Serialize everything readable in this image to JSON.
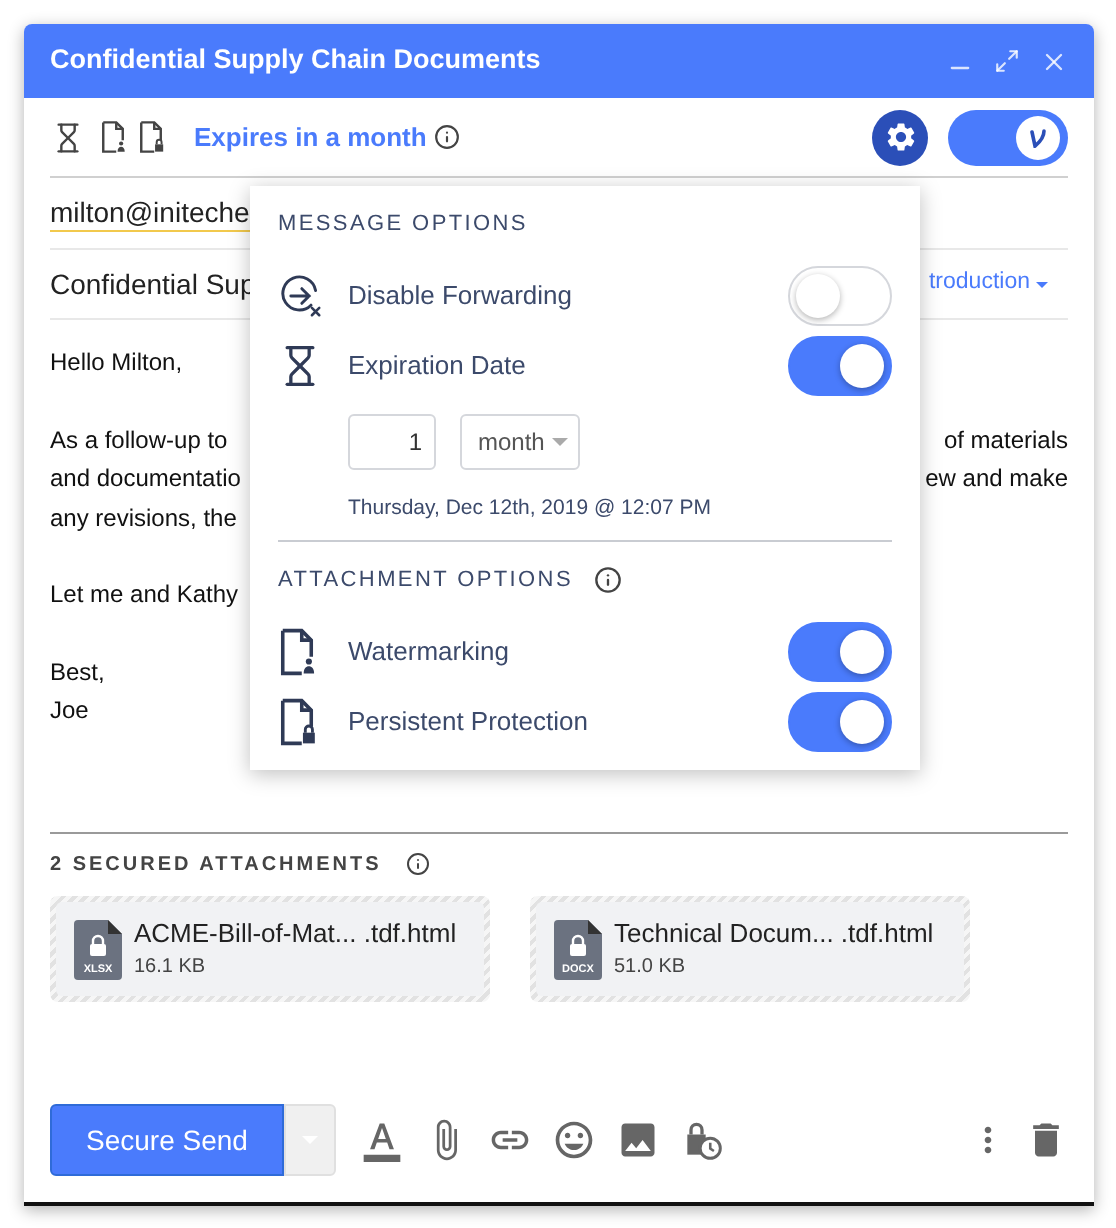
{
  "window": {
    "title": "Confidential Supply Chain Documents"
  },
  "toolbar": {
    "expiry_label": "Expires in a month",
    "protection_on": true
  },
  "compose": {
    "recipient": "milton@initeche",
    "subject": "Confidential Sup",
    "template_link": "troduction",
    "body": [
      {
        "lines": [
          {
            "left": "Hello Milton,"
          }
        ]
      },
      {
        "lines": [
          {
            "left": "As a follow-up to",
            "right": "of materials"
          },
          {
            "left": "and documentatio",
            "right": "ew and make"
          },
          {
            "left": "any revisions, the"
          }
        ]
      },
      {
        "lines": [
          {
            "left": "Let me and Kathy"
          }
        ]
      },
      {
        "lines": [
          {
            "left": "Best,"
          },
          {
            "left": "Joe"
          }
        ]
      }
    ]
  },
  "options_popup": {
    "sections": [
      {
        "heading": "MESSAGE OPTIONS",
        "info": false,
        "items": [
          {
            "kind": "toggle",
            "label": "Disable Forwarding",
            "on": false
          },
          {
            "kind": "expiration",
            "label": "Expiration Date",
            "on": true,
            "amount": "1",
            "unit": "month",
            "date_text": "Thursday, Dec 12th, 2019 @ 12:07 PM"
          }
        ]
      },
      {
        "heading": "ATTACHMENT OPTIONS",
        "info": true,
        "items": [
          {
            "kind": "toggle",
            "label": "Watermarking",
            "on": true
          },
          {
            "kind": "toggle",
            "label": "Persistent Protection",
            "on": true
          }
        ]
      }
    ]
  },
  "attachments": {
    "heading": "2 SECURED ATTACHMENTS",
    "items": [
      {
        "name": "ACME-Bill-of-Mat... .tdf.html",
        "size": "16.1 KB",
        "type": "XLSX"
      },
      {
        "name": "Technical Docum... .tdf.html",
        "size": "51.0 KB",
        "type": "DOCX"
      }
    ]
  },
  "footer": {
    "send_label": "Secure Send"
  }
}
